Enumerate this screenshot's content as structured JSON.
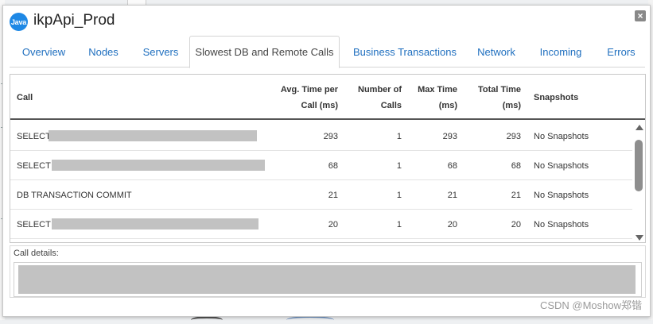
{
  "window": {
    "badge": "Java",
    "title": "ikpApi_Prod",
    "close_icon": "×"
  },
  "tabs": [
    {
      "label": "Overview"
    },
    {
      "label": "Nodes"
    },
    {
      "label": "Servers"
    },
    {
      "label": "Slowest DB and Remote Calls",
      "active": true
    },
    {
      "label": "Business Transactions"
    },
    {
      "label": "Network"
    },
    {
      "label": "Incoming"
    },
    {
      "label": "Errors"
    }
  ],
  "table": {
    "headers": {
      "call": "Call",
      "avg_time_1": "Avg. Time per",
      "avg_time_2": "Call (ms)",
      "num_calls_1": "Number of",
      "num_calls_2": "Calls",
      "max_time_1": "Max Time",
      "max_time_2": "(ms)",
      "total_time_1": "Total Time",
      "total_time_2": "(ms)",
      "snapshots": "Snapshots"
    },
    "rows": [
      {
        "call": "SELECT",
        "avg": "293",
        "num": "1",
        "max": "293",
        "total": "293",
        "snapshots": "No Snapshots"
      },
      {
        "call": "SELECT '",
        "avg": "68",
        "num": "1",
        "max": "68",
        "total": "68",
        "snapshots": "No Snapshots"
      },
      {
        "call": "DB TRANSACTION COMMIT",
        "avg": "21",
        "num": "1",
        "max": "21",
        "total": "21",
        "snapshots": "No Snapshots"
      },
      {
        "call": "SELECT '",
        "avg": "20",
        "num": "1",
        "max": "20",
        "total": "20",
        "snapshots": "No Snapshots"
      }
    ]
  },
  "details": {
    "label": "Call details:"
  },
  "watermark": "CSDN @Moshow郑锴",
  "colors": {
    "accent": "#1f6fbf",
    "badge": "#1e88e5",
    "redaction": "#c2c2c2"
  },
  "icons": {
    "close": "close-icon",
    "scroll_up": "chevron-up-icon",
    "scroll_down": "chevron-down-icon"
  }
}
